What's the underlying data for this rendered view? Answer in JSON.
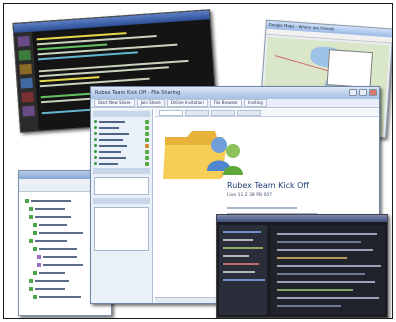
{
  "collage": {
    "terminal": {
      "title": ""
    },
    "map": {
      "title": "Google Maps - Where are friends"
    },
    "file_manager": {
      "title": ""
    },
    "main_app": {
      "title": "Rubex Team Kick Off - File Sharing",
      "toolbar_tabs": [
        "Start New Share",
        "Join Share",
        "Online Invitation",
        "File Browser",
        "Inviting",
        "Session Information"
      ],
      "product_name": "Rubex Team Kick Off",
      "version": "Live 11.2.38 PB 007"
    },
    "noisy_capture": {
      "title": ""
    },
    "colors": {
      "frame_border": "#1a1a1a",
      "app_title_blue": "#1f3d74",
      "terminal_bg": "#141414"
    }
  }
}
